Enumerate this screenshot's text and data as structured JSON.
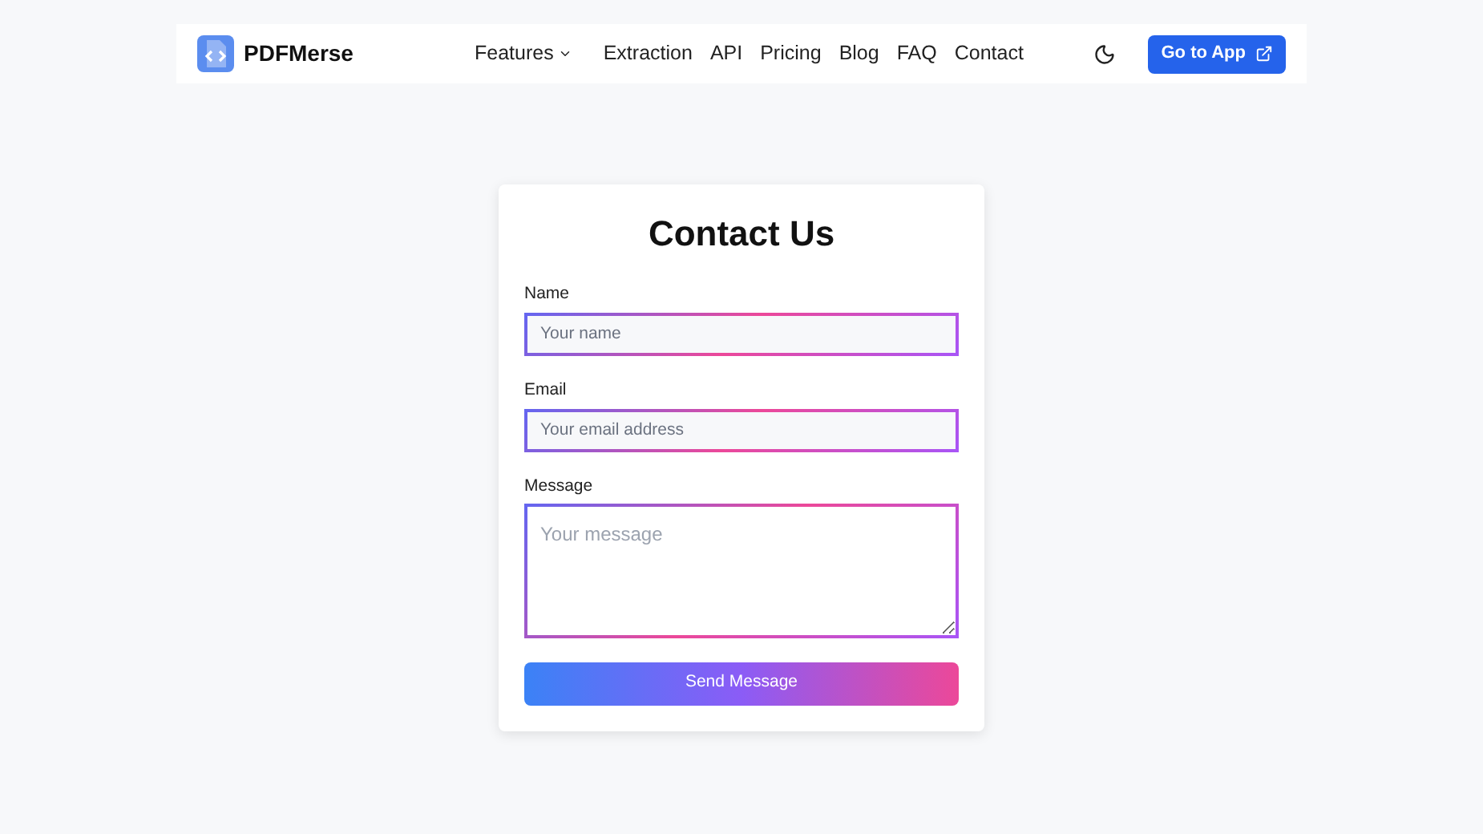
{
  "header": {
    "brand": "PDFMerse",
    "nav": [
      {
        "label": "Features",
        "dropdown": true
      },
      {
        "label": "Extraction",
        "dropdown": false
      },
      {
        "label": "API",
        "dropdown": false
      },
      {
        "label": "Pricing",
        "dropdown": false
      },
      {
        "label": "Blog",
        "dropdown": false
      },
      {
        "label": "FAQ",
        "dropdown": false
      },
      {
        "label": "Contact",
        "dropdown": false
      }
    ],
    "cta": "Go to App"
  },
  "form": {
    "title": "Contact Us",
    "fields": [
      {
        "kind": "input",
        "label": "Name",
        "placeholder": "Your name"
      },
      {
        "kind": "input",
        "label": "Email",
        "placeholder": "Your email address"
      },
      {
        "kind": "textarea",
        "label": "Message",
        "placeholder": "Your message"
      }
    ],
    "submit": "Send Message"
  }
}
